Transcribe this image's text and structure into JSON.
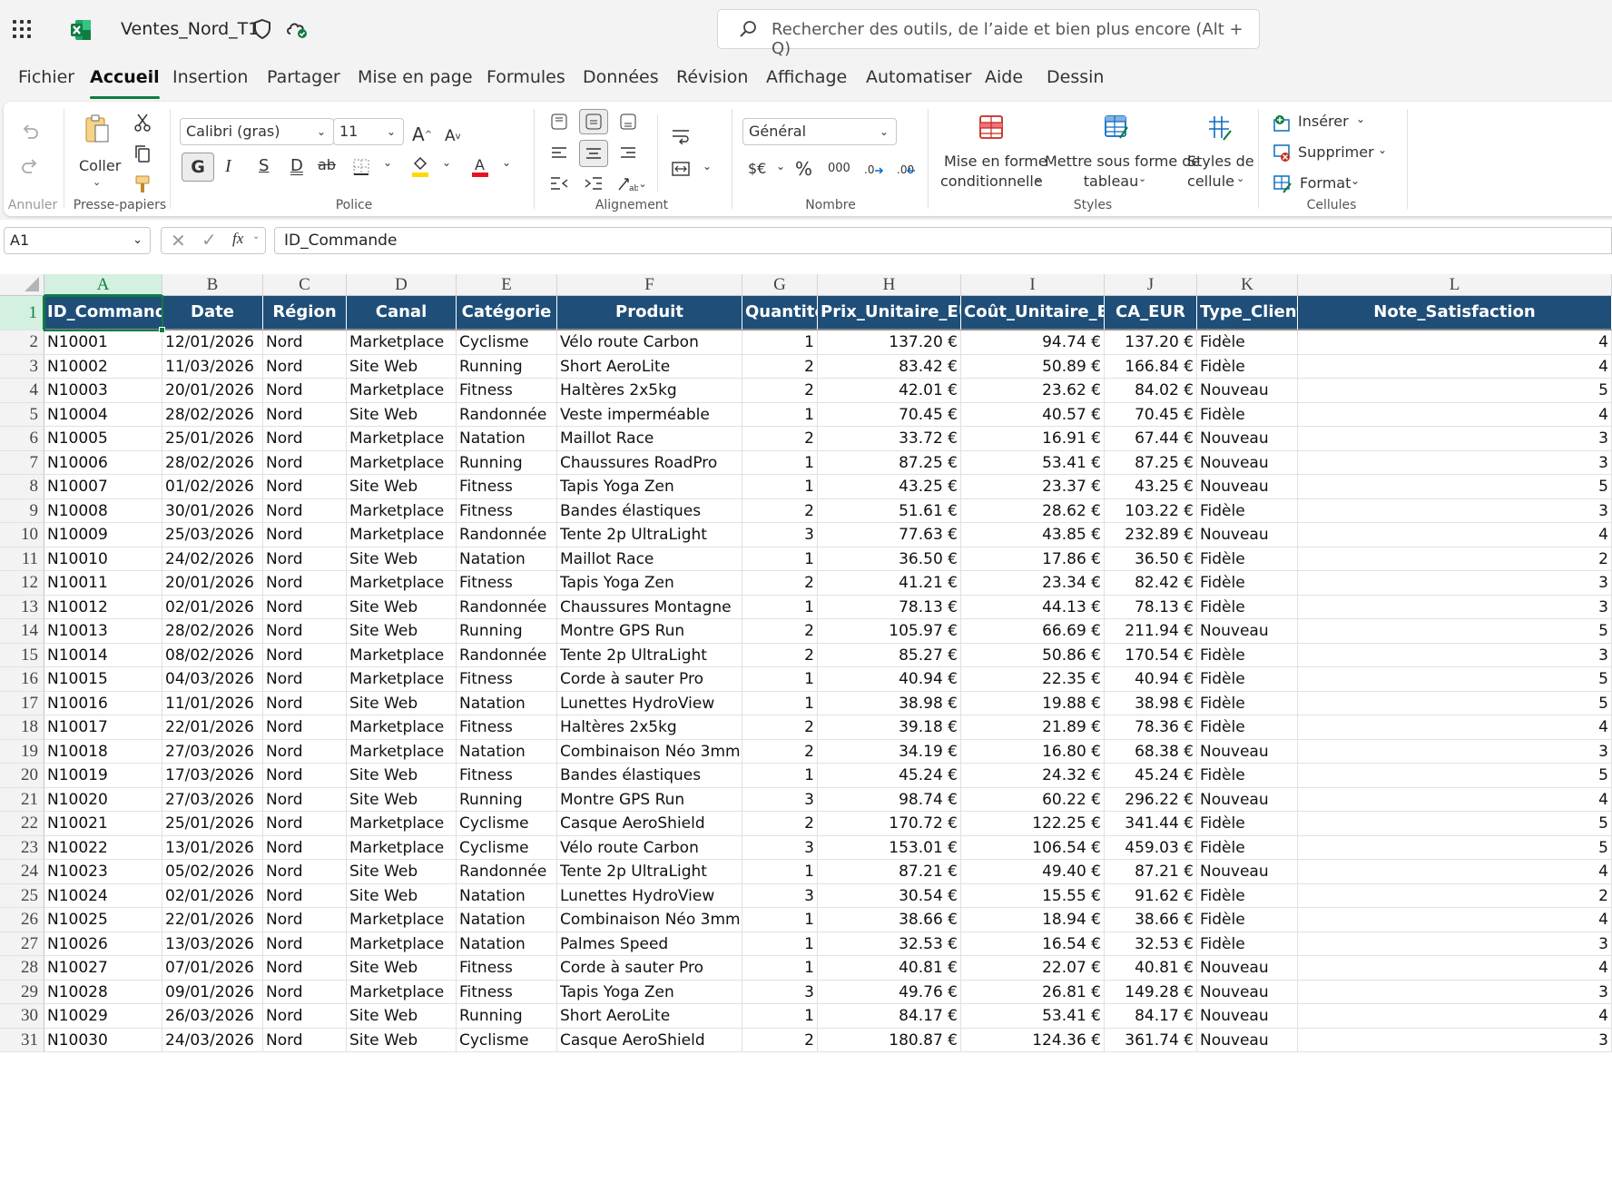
{
  "app": {
    "title": "Ventes_Nord_T1"
  },
  "search": {
    "placeholder": "Rechercher des outils, de l’aide et bien plus encore (Alt + Q)"
  },
  "menu": {
    "tabs": [
      "Fichier",
      "Accueil",
      "Insertion",
      "Partager",
      "Mise en page",
      "Formules",
      "Données",
      "Révision",
      "Affichage",
      "Automatiser",
      "Aide",
      "Dessin"
    ],
    "active": "Accueil"
  },
  "ribbon": {
    "undo": {
      "label": "Annuler"
    },
    "clipboard": {
      "paste": "Coller",
      "label": "Presse-papiers"
    },
    "font": {
      "name": "Calibri (gras)",
      "size": "11",
      "label": "Police",
      "bold": "G",
      "italic": "I",
      "strike": "S",
      "underline": "D",
      "fill_color": "#ffd800",
      "font_color": "#e81123"
    },
    "alignment": {
      "label": "Alignement"
    },
    "number": {
      "format": "Général",
      "label": "Nombre",
      "currency": "$€",
      "percent": "%",
      "thousands": "000"
    },
    "styles": {
      "cond_format_1": "Mise en forme",
      "cond_format_2": "conditionnelle",
      "table_1": "Mettre sous forme de",
      "table_2": "tableau",
      "cell_styles_1": "Styles de",
      "cell_styles_2": "cellule",
      "label": "Styles"
    },
    "cells": {
      "insert": "Insérer",
      "delete": "Supprimer",
      "format": "Format",
      "label": "Cellules"
    }
  },
  "formula_bar": {
    "name_box": "A1",
    "fx": "fx",
    "value": "ID_Commande"
  },
  "sheet": {
    "columns": [
      "A",
      "B",
      "C",
      "D",
      "E",
      "F",
      "G",
      "H",
      "I",
      "J",
      "K",
      "L"
    ],
    "selected_cell": "A1",
    "header_fill": "#1f4e78",
    "headers": [
      "ID_Commande",
      "Date",
      "Région",
      "Canal",
      "Catégorie",
      "Produit",
      "Quantité",
      "Prix_Unitaire_EUR",
      "Coût_Unitaire_EUR",
      "CA_EUR",
      "Type_Client",
      "Note_Satisfaction"
    ],
    "rows": [
      [
        "N10001",
        "12/01/2026",
        "Nord",
        "Marketplace",
        "Cyclisme",
        "Vélo route Carbon",
        "1",
        "137.20 €",
        "94.74 €",
        "137.20 €",
        "Fidèle",
        "4"
      ],
      [
        "N10002",
        "11/03/2026",
        "Nord",
        "Site Web",
        "Running",
        "Short AeroLite",
        "2",
        "83.42 €",
        "50.89 €",
        "166.84 €",
        "Fidèle",
        "4"
      ],
      [
        "N10003",
        "20/01/2026",
        "Nord",
        "Marketplace",
        "Fitness",
        "Haltères 2x5kg",
        "2",
        "42.01 €",
        "23.62 €",
        "84.02 €",
        "Nouveau",
        "5"
      ],
      [
        "N10004",
        "28/02/2026",
        "Nord",
        "Site Web",
        "Randonnée",
        "Veste imperméable",
        "1",
        "70.45 €",
        "40.57 €",
        "70.45 €",
        "Fidèle",
        "4"
      ],
      [
        "N10005",
        "25/01/2026",
        "Nord",
        "Marketplace",
        "Natation",
        "Maillot Race",
        "2",
        "33.72 €",
        "16.91 €",
        "67.44 €",
        "Nouveau",
        "3"
      ],
      [
        "N10006",
        "28/02/2026",
        "Nord",
        "Marketplace",
        "Running",
        "Chaussures RoadPro",
        "1",
        "87.25 €",
        "53.41 €",
        "87.25 €",
        "Nouveau",
        "3"
      ],
      [
        "N10007",
        "01/02/2026",
        "Nord",
        "Site Web",
        "Fitness",
        "Tapis Yoga Zen",
        "1",
        "43.25 €",
        "23.37 €",
        "43.25 €",
        "Nouveau",
        "5"
      ],
      [
        "N10008",
        "30/01/2026",
        "Nord",
        "Marketplace",
        "Fitness",
        "Bandes élastiques",
        "2",
        "51.61 €",
        "28.62 €",
        "103.22 €",
        "Fidèle",
        "3"
      ],
      [
        "N10009",
        "25/03/2026",
        "Nord",
        "Marketplace",
        "Randonnée",
        "Tente 2p UltraLight",
        "3",
        "77.63 €",
        "43.85 €",
        "232.89 €",
        "Nouveau",
        "4"
      ],
      [
        "N10010",
        "24/02/2026",
        "Nord",
        "Site Web",
        "Natation",
        "Maillot Race",
        "1",
        "36.50 €",
        "17.86 €",
        "36.50 €",
        "Fidèle",
        "2"
      ],
      [
        "N10011",
        "20/01/2026",
        "Nord",
        "Marketplace",
        "Fitness",
        "Tapis Yoga Zen",
        "2",
        "41.21 €",
        "23.34 €",
        "82.42 €",
        "Fidèle",
        "3"
      ],
      [
        "N10012",
        "02/01/2026",
        "Nord",
        "Site Web",
        "Randonnée",
        "Chaussures Montagne",
        "1",
        "78.13 €",
        "44.13 €",
        "78.13 €",
        "Fidèle",
        "3"
      ],
      [
        "N10013",
        "28/02/2026",
        "Nord",
        "Site Web",
        "Running",
        "Montre GPS Run",
        "2",
        "105.97 €",
        "66.69 €",
        "211.94 €",
        "Nouveau",
        "5"
      ],
      [
        "N10014",
        "08/02/2026",
        "Nord",
        "Marketplace",
        "Randonnée",
        "Tente 2p UltraLight",
        "2",
        "85.27 €",
        "50.86 €",
        "170.54 €",
        "Fidèle",
        "3"
      ],
      [
        "N10015",
        "04/03/2026",
        "Nord",
        "Marketplace",
        "Fitness",
        "Corde à sauter Pro",
        "1",
        "40.94 €",
        "22.35 €",
        "40.94 €",
        "Fidèle",
        "5"
      ],
      [
        "N10016",
        "11/01/2026",
        "Nord",
        "Site Web",
        "Natation",
        "Lunettes HydroView",
        "1",
        "38.98 €",
        "19.88 €",
        "38.98 €",
        "Fidèle",
        "5"
      ],
      [
        "N10017",
        "22/01/2026",
        "Nord",
        "Marketplace",
        "Fitness",
        "Haltères 2x5kg",
        "2",
        "39.18 €",
        "21.89 €",
        "78.36 €",
        "Fidèle",
        "4"
      ],
      [
        "N10018",
        "27/03/2026",
        "Nord",
        "Marketplace",
        "Natation",
        "Combinaison Néo 3mm",
        "2",
        "34.19 €",
        "16.80 €",
        "68.38 €",
        "Nouveau",
        "3"
      ],
      [
        "N10019",
        "17/03/2026",
        "Nord",
        "Site Web",
        "Fitness",
        "Bandes élastiques",
        "1",
        "45.24 €",
        "24.32 €",
        "45.24 €",
        "Fidèle",
        "5"
      ],
      [
        "N10020",
        "27/03/2026",
        "Nord",
        "Site Web",
        "Running",
        "Montre GPS Run",
        "3",
        "98.74 €",
        "60.22 €",
        "296.22 €",
        "Nouveau",
        "4"
      ],
      [
        "N10021",
        "25/01/2026",
        "Nord",
        "Marketplace",
        "Cyclisme",
        "Casque AeroShield",
        "2",
        "170.72 €",
        "122.25 €",
        "341.44 €",
        "Fidèle",
        "5"
      ],
      [
        "N10022",
        "13/01/2026",
        "Nord",
        "Marketplace",
        "Cyclisme",
        "Vélo route Carbon",
        "3",
        "153.01 €",
        "106.54 €",
        "459.03 €",
        "Fidèle",
        "5"
      ],
      [
        "N10023",
        "05/02/2026",
        "Nord",
        "Site Web",
        "Randonnée",
        "Tente 2p UltraLight",
        "1",
        "87.21 €",
        "49.40 €",
        "87.21 €",
        "Nouveau",
        "4"
      ],
      [
        "N10024",
        "02/01/2026",
        "Nord",
        "Site Web",
        "Natation",
        "Lunettes HydroView",
        "3",
        "30.54 €",
        "15.55 €",
        "91.62 €",
        "Fidèle",
        "2"
      ],
      [
        "N10025",
        "22/01/2026",
        "Nord",
        "Marketplace",
        "Natation",
        "Combinaison Néo 3mm",
        "1",
        "38.66 €",
        "18.94 €",
        "38.66 €",
        "Fidèle",
        "4"
      ],
      [
        "N10026",
        "13/03/2026",
        "Nord",
        "Marketplace",
        "Natation",
        "Palmes Speed",
        "1",
        "32.53 €",
        "16.54 €",
        "32.53 €",
        "Fidèle",
        "3"
      ],
      [
        "N10027",
        "07/01/2026",
        "Nord",
        "Site Web",
        "Fitness",
        "Corde à sauter Pro",
        "1",
        "40.81 €",
        "22.07 €",
        "40.81 €",
        "Nouveau",
        "4"
      ],
      [
        "N10028",
        "09/01/2026",
        "Nord",
        "Marketplace",
        "Fitness",
        "Tapis Yoga Zen",
        "3",
        "49.76 €",
        "26.81 €",
        "149.28 €",
        "Nouveau",
        "3"
      ],
      [
        "N10029",
        "26/03/2026",
        "Nord",
        "Site Web",
        "Running",
        "Short AeroLite",
        "1",
        "84.17 €",
        "53.41 €",
        "84.17 €",
        "Nouveau",
        "4"
      ],
      [
        "N10030",
        "24/03/2026",
        "Nord",
        "Site Web",
        "Cyclisme",
        "Casque AeroShield",
        "2",
        "180.87 €",
        "124.36 €",
        "361.74 €",
        "Nouveau",
        "3"
      ]
    ]
  }
}
